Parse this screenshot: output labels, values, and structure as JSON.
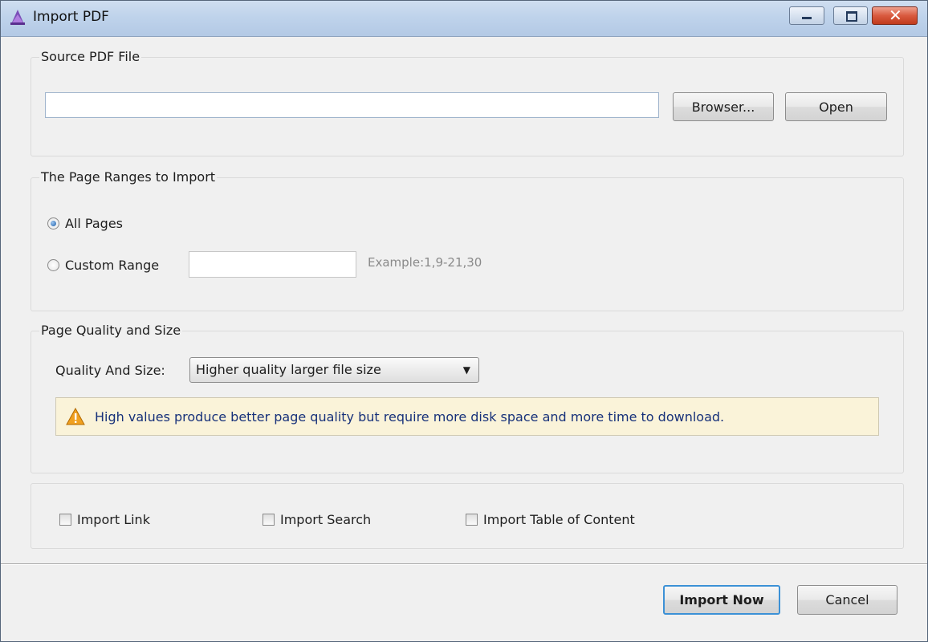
{
  "window": {
    "title": "Import PDF",
    "close_glyph": "✕"
  },
  "source": {
    "group_label": "Source PDF File",
    "path_value": "",
    "browse_label": "Browser...",
    "open_label": "Open"
  },
  "ranges": {
    "group_label": "The Page Ranges to Import",
    "all_pages_label": "All Pages",
    "all_pages_checked": true,
    "custom_range_label": "Custom Range",
    "custom_range_value": "",
    "example_text": "Example:1,9-21,30"
  },
  "quality": {
    "group_label": "Page Quality and Size",
    "field_label": "Quality And Size:",
    "selected": "Higher quality larger file size",
    "warning": "High values produce better page quality but require more disk space and more time to download.",
    "warning_icon": "warning-triangle-icon"
  },
  "options": {
    "import_link": "Import Link",
    "import_search": "Import Search",
    "import_toc": "Import Table of Content"
  },
  "footer": {
    "import_now": "Import Now",
    "cancel": "Cancel"
  },
  "colors": {
    "accent": "#3c91d6",
    "warning_bg": "#faf3d9",
    "warning_text": "#17317a"
  }
}
